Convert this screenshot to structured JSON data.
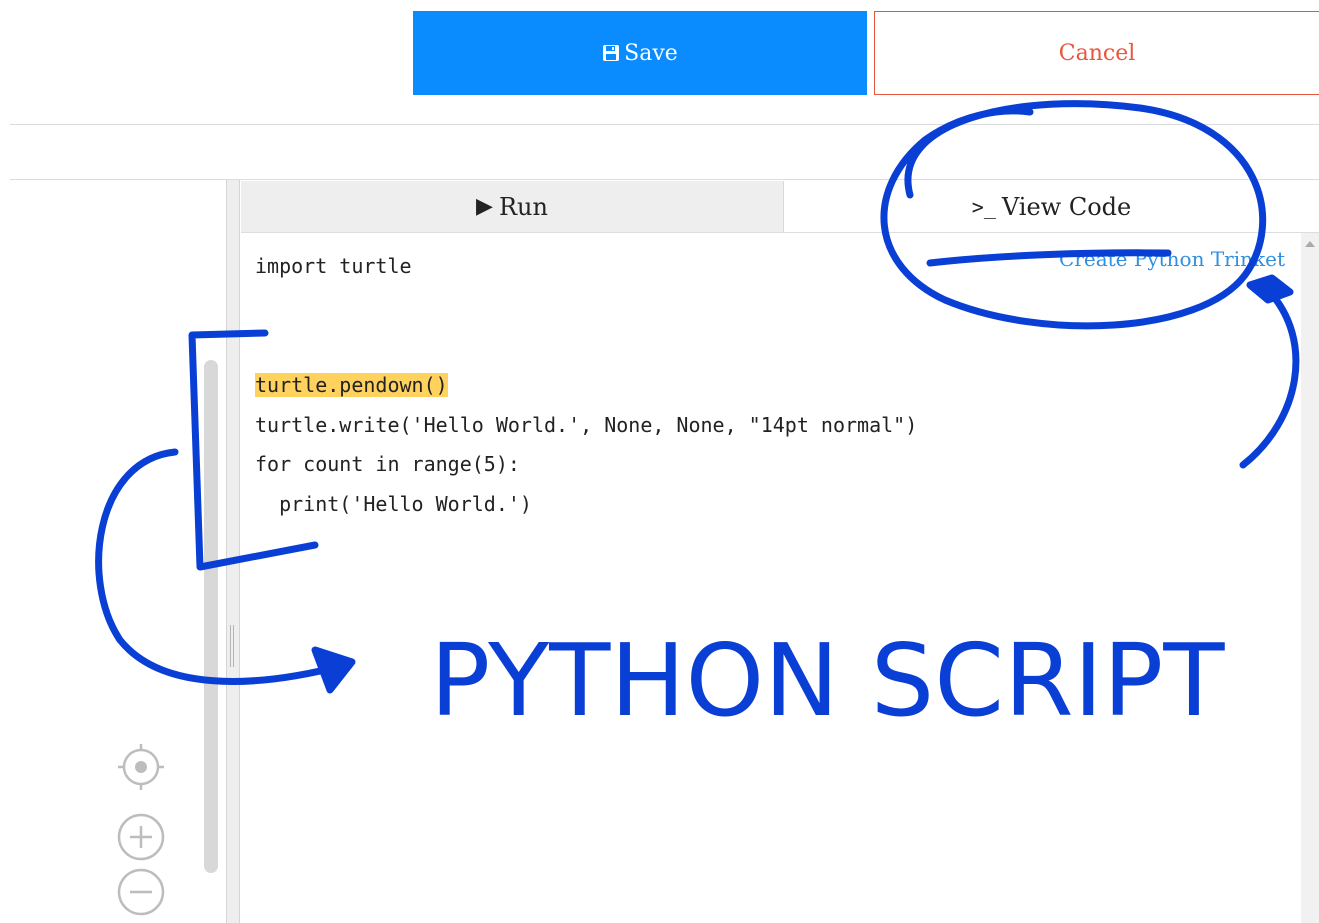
{
  "toolbar": {
    "save_label": "Save",
    "cancel_label": "Cancel"
  },
  "tabs": [
    {
      "label": "Run",
      "active": false
    },
    {
      "label": "View Code",
      "active": true
    }
  ],
  "editor": {
    "create_link": "Create Python Trinket",
    "lines": [
      {
        "text": "import turtle",
        "highlight": false
      },
      {
        "text": "",
        "highlight": false
      },
      {
        "text": "",
        "highlight": false
      },
      {
        "text": "turtle.pendown()",
        "highlight": true
      },
      {
        "text": "turtle.write('Hello World.', None, None, \"14pt normal\")",
        "highlight": false
      },
      {
        "text": "for count in range(5):",
        "highlight": false
      },
      {
        "text": "  print('Hello World.')",
        "highlight": false
      }
    ]
  },
  "annotation": {
    "label": "PYTHON SCRIPT",
    "ink_color": "#0a3fd6"
  },
  "map_controls": [
    "locate-icon",
    "zoom-in-icon",
    "zoom-out-icon"
  ],
  "colors": {
    "save_bg": "#0a8cff",
    "cancel_text": "#e8563e",
    "highlight": "#ffd25e",
    "link": "#2f8fe0"
  }
}
